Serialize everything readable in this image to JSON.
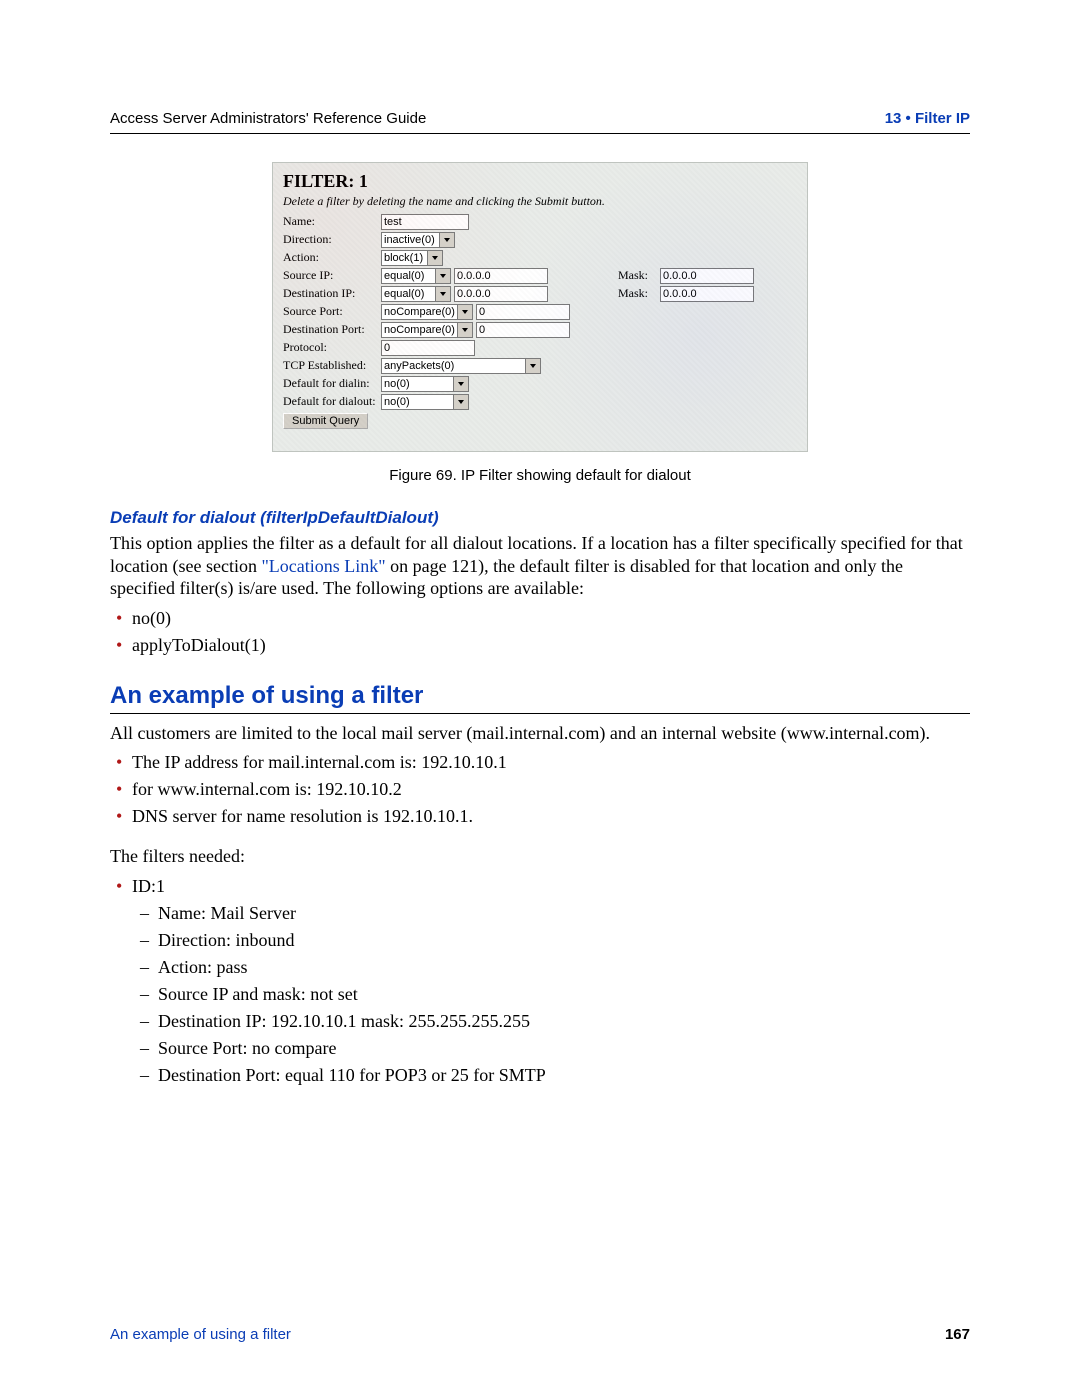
{
  "header": {
    "left": "Access Server Administrators' Reference Guide",
    "right": "13 • Filter IP"
  },
  "screenshot": {
    "title": "FILTER: 1",
    "subtitle": "Delete a filter by deleting the name and clicking the Submit button.",
    "rows": {
      "name_label": "Name:",
      "name_value": "test",
      "direction_label": "Direction:",
      "direction_value": "inactive(0)",
      "action_label": "Action:",
      "action_value": "block(1)",
      "srcip_label": "Source IP:",
      "srcip_op": "equal(0)",
      "srcip_val": "0.0.0.0",
      "srcip_mask_label": "Mask:",
      "srcip_mask_val": "0.0.0.0",
      "dstip_label": "Destination IP:",
      "dstip_op": "equal(0)",
      "dstip_val": "0.0.0.0",
      "dstip_mask_label": "Mask:",
      "dstip_mask_val": "0.0.0.0",
      "srcport_label": "Source Port:",
      "srcport_op": "noCompare(0)",
      "srcport_val": "0",
      "dstport_label": "Destination Port:",
      "dstport_op": "noCompare(0)",
      "dstport_val": "0",
      "protocol_label": "Protocol:",
      "protocol_val": "0",
      "tcp_label": "TCP Established:",
      "tcp_val": "anyPackets(0)",
      "def_dialin_label": "Default for dialin:",
      "def_dialin_val": "no(0)",
      "def_dialout_label": "Default for dialout:",
      "def_dialout_val": "no(0)"
    },
    "submit": "Submit Query"
  },
  "fig_caption": "Figure 69. IP Filter showing default for dialout",
  "section_sub": "Default for dialout (filterIpDefaultDialout)",
  "para1_a": "This option applies the filter as a default for all dialout locations.  If a location has a filter specifically specified for that location (see section ",
  "para1_link": "\"Locations Link\"",
  "para1_b": " on page 121), the default filter is disabled for that location and only the specified filter(s) is/are used. The following options are available:",
  "opts": {
    "a": "no(0)",
    "b": "applyToDialout(1)"
  },
  "section_title": "An example of using a filter",
  "para2": "All customers are limited to the local mail server (mail.internal.com) and an internal website (www.internal.com).",
  "addr": {
    "a": "The IP address for mail.internal.com is: 192.10.10.1",
    "b": "for www.internal.com is: 192.10.10.2",
    "c": "DNS server for name resolution is 192.10.10.1."
  },
  "filters_needed": "The filters needed:",
  "filter1": {
    "id": "ID:1",
    "name": "Name: Mail Server",
    "direction": "Direction: inbound",
    "action": "Action: pass",
    "srcip": "Source IP and mask: not set",
    "dstip": "Destination IP: 192.10.10.1 mask: 255.255.255.255",
    "srcport": "Source Port: no compare",
    "dstport": "Destination Port: equal 110 for POP3 or 25 for SMTP"
  },
  "footer": {
    "left": "An example of using a filter",
    "right": "167"
  }
}
